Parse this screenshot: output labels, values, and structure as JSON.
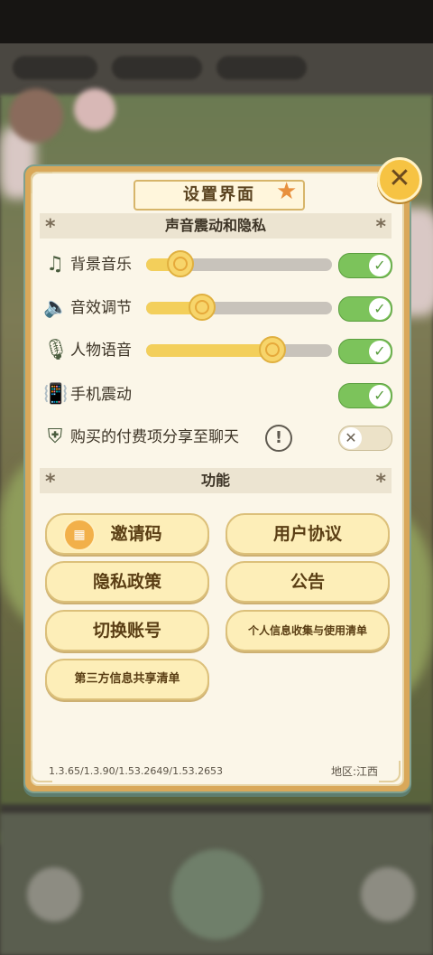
{
  "dialog": {
    "title": "设置界面",
    "close_icon": "close-icon"
  },
  "sound_section": {
    "header": "声音震动和隐私",
    "rows": [
      {
        "label": "背景音乐",
        "icon": "music-note-icon",
        "slider": 0.18,
        "toggle": true
      },
      {
        "label": "音效调节",
        "icon": "speaker-icon",
        "slider": 0.3,
        "toggle": true
      },
      {
        "label": "人物语音",
        "icon": "microphone-icon",
        "slider": 0.68,
        "toggle": true
      },
      {
        "label": "手机震动",
        "icon": "phone-vibrate-icon",
        "toggle": true
      },
      {
        "label": "购买的付费项分享至聊天",
        "icon": "shield-icon",
        "toggle": false
      }
    ]
  },
  "function_section": {
    "header": "功能",
    "buttons": {
      "invite": "邀请码",
      "user_agreement": "用户协议",
      "privacy": "隐私政策",
      "announcement": "公告",
      "switch_account": "切换账号",
      "personal_info": "个人信息收集与使用清单",
      "third_party": "第三方信息共享清单"
    }
  },
  "footer": {
    "version": "1.3.65/1.3.90/1.53.2649/1.53.2653",
    "region": "地区:江西"
  },
  "colors": {
    "toggle_on": "#7cc35b",
    "slider_fill": "#f3cf5b",
    "panel_bg": "#fbf6e8",
    "button_bg": "#fdeeb8"
  }
}
